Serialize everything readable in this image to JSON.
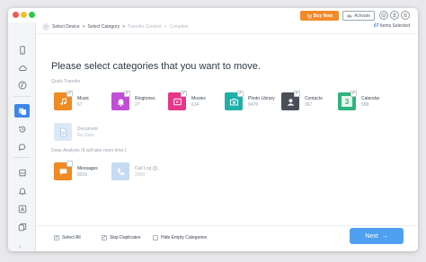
{
  "window": {
    "buy_label": "Buy Now",
    "activate_label": "Activate"
  },
  "breadcrumb": {
    "items": [
      "Select Device",
      "Select Category",
      "Transfer Content",
      "Complete"
    ],
    "separator": ">"
  },
  "selection": {
    "count": "67",
    "label": "Items Selected"
  },
  "heading": "Please select categories that you want to move.",
  "quick_transfer": {
    "label": "Quick Transfer",
    "categories": [
      {
        "name": "Music",
        "count": "67",
        "color": "#f08a24",
        "icon": "music-icon",
        "checked": true
      },
      {
        "name": "Ringtones",
        "count": "27",
        "color": "#c14fd6",
        "icon": "bell-icon",
        "checked": true
      },
      {
        "name": "Movies",
        "count": "614",
        "color": "#e6368a",
        "icon": "film-icon",
        "checked": true
      },
      {
        "name": "Photo Library",
        "count": "9476",
        "color": "#1fb0a8",
        "icon": "camera-icon",
        "checked": true
      },
      {
        "name": "Contacts",
        "count": "367",
        "color": "#4a4f57",
        "icon": "contact-icon",
        "checked": true
      },
      {
        "name": "Calendar",
        "count": "589",
        "color": "#2fb37f",
        "icon": "calendar-icon",
        "checked": true,
        "calendar_day": "3"
      },
      {
        "name": "Document",
        "count": "No Data",
        "color": "#dbe8f7",
        "icon": "document-icon",
        "checked": false,
        "disabled": true
      }
    ]
  },
  "deep_analysis": {
    "label": "Deep Analysis (It will take more time.)",
    "categories": [
      {
        "name": "Messages",
        "count": "8916",
        "color": "#f08a24",
        "icon": "message-icon",
        "checked": false
      },
      {
        "name": "Call Log",
        "count": "2000",
        "color": "#c6dbf3",
        "icon": "phone-icon",
        "checked": false,
        "disabled": true
      }
    ]
  },
  "footer": {
    "select_all": {
      "label": "Select All",
      "checked": true
    },
    "skip_duplicates": {
      "label": "Skip Duplicates",
      "checked": true
    },
    "hide_empty": {
      "label": "Hide Empty Categories",
      "checked": false
    },
    "next_label": "Next",
    "next_arrow": "→"
  },
  "sidebar": {
    "items": [
      {
        "icon": "phone-icon"
      },
      {
        "icon": "cloud-icon"
      },
      {
        "icon": "music-icon"
      },
      {
        "icon": "transfer-icon",
        "active": true
      },
      {
        "icon": "history-icon"
      },
      {
        "icon": "chat-icon"
      },
      {
        "icon": "bus-icon"
      },
      {
        "icon": "bell-icon"
      },
      {
        "icon": "appstore-icon"
      },
      {
        "icon": "copy-icon"
      }
    ],
    "toggle": "›"
  }
}
